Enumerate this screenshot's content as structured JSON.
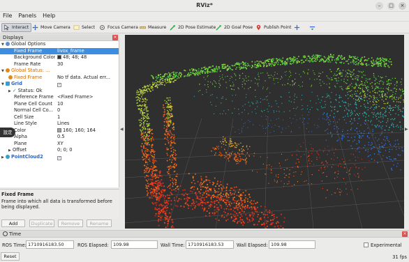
{
  "window": {
    "title": "RViz*"
  },
  "menu": [
    "File",
    "Panels",
    "Help"
  ],
  "toolbar": [
    {
      "label": "Interact",
      "icon": "interact-icon",
      "active": true
    },
    {
      "label": "Move Camera",
      "icon": "move-camera-icon"
    },
    {
      "label": "Select",
      "icon": "select-icon"
    },
    {
      "label": "Focus Camera",
      "icon": "focus-camera-icon"
    },
    {
      "label": "Measure",
      "icon": "measure-icon"
    },
    {
      "label": "2D Pose Estimate",
      "icon": "pose-estimate-icon"
    },
    {
      "label": "2D Goal Pose",
      "icon": "goal-pose-icon"
    },
    {
      "label": "Publish Point",
      "icon": "publish-point-icon"
    }
  ],
  "displays": {
    "title": "Displays",
    "rows": [
      {
        "key": "Global Options",
        "val": ""
      },
      {
        "key": "Fixed Frame",
        "val": "livox_frame"
      },
      {
        "key": "Background Color",
        "val": "48; 48; 48"
      },
      {
        "key": "Frame Rate",
        "val": "30"
      },
      {
        "key": "Global Status: ...",
        "val": ""
      },
      {
        "key": "Fixed Frame",
        "val": "No tf data.  Actual err..."
      },
      {
        "key": "Grid",
        "val": ""
      },
      {
        "key": "Status: Ok",
        "val": ""
      },
      {
        "key": "Reference Frame",
        "val": "<Fixed Frame>"
      },
      {
        "key": "Plane Cell Count",
        "val": "10"
      },
      {
        "key": "Normal Cell Co...",
        "val": "0"
      },
      {
        "key": "Cell Size",
        "val": "1"
      },
      {
        "key": "Line Style",
        "val": "Lines"
      },
      {
        "key": "Color",
        "val": "160; 160; 164"
      },
      {
        "key": "Alpha",
        "val": "0.5"
      },
      {
        "key": "Plane",
        "val": "XY"
      },
      {
        "key": "Offset",
        "val": "0; 0; 0"
      },
      {
        "key": "PointCloud2",
        "val": ""
      }
    ],
    "floating_badge": "設定",
    "description_title": "Fixed Frame",
    "description_text": "Frame into which all data is transformed before being displayed.",
    "buttons": {
      "add": "Add",
      "duplicate": "Duplicate",
      "remove": "Remove",
      "rename": "Rename"
    }
  },
  "colors": {
    "background_color": "#303030",
    "grid_color": "#a0a0a4",
    "selection": "#3d8ee0"
  },
  "time": {
    "title": "Time",
    "ros_time_label": "ROS Time:",
    "ros_time": "1710916183.50",
    "ros_elapsed_label": "ROS Elapsed:",
    "ros_elapsed": "109.98",
    "wall_time_label": "Wall Time:",
    "wall_time": "1710916183.53",
    "wall_elapsed_label": "Wall Elapsed:",
    "wall_elapsed": "109.98",
    "experimental_label": "Experimental",
    "reset_label": "Reset",
    "fps": "31 fps"
  }
}
